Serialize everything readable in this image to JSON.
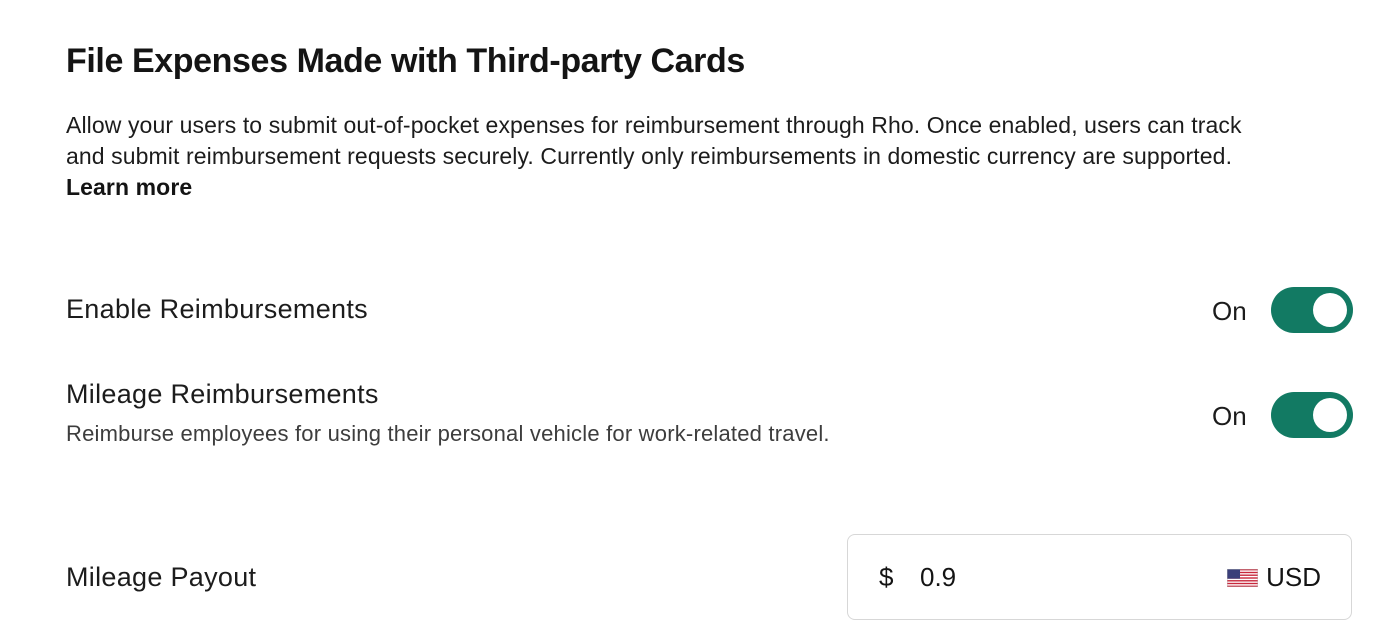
{
  "header": {
    "title": "File Expenses Made with Third-party Cards",
    "description_line1": "Allow your users to submit out-of-pocket expenses for reimbursement through Rho. Once enabled, users can track",
    "description_line2": "and submit reimbursement requests securely. Currently only reimbursements in domestic currency are supported.",
    "learn_more": "Learn more"
  },
  "settings": {
    "enable_reimbursements": {
      "label": "Enable Reimbursements",
      "state": "On",
      "enabled": true
    },
    "mileage_reimbursements": {
      "label": "Mileage Reimbursements",
      "description": "Reimburse employees for using their personal vehicle for work-related travel.",
      "state": "On",
      "enabled": true
    },
    "mileage_payout": {
      "label": "Mileage Payout",
      "currency_symbol": "$",
      "value": "0.9",
      "currency_code": "USD",
      "flag_icon": "us-flag-icon"
    }
  },
  "colors": {
    "toggle_on": "#127a63",
    "text_primary": "#141414",
    "border": "#d7d7d7"
  }
}
